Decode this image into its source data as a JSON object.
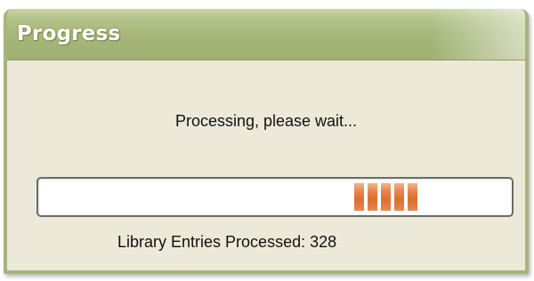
{
  "window": {
    "title": "Progress"
  },
  "dialog": {
    "message": "Processing, please wait...",
    "status_label": "Library Entries Processed:",
    "status_count": "328"
  },
  "progress": {
    "mode": "marquee",
    "block_count": 5,
    "position_fraction": 0.77,
    "color": "#e07a3c"
  }
}
